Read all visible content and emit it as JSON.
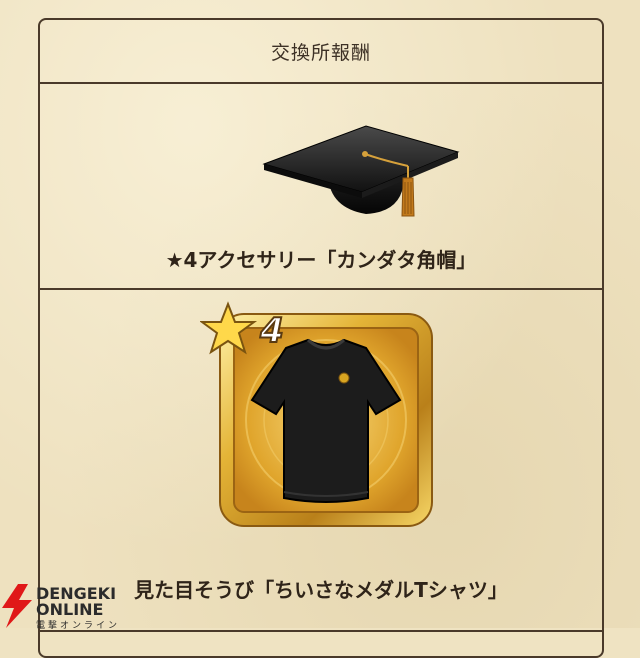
{
  "header": {
    "title": "交換所報酬"
  },
  "rewards": [
    {
      "name": "★4アクセサリー「カンダタ角帽」",
      "icon": "graduation-cap-icon"
    },
    {
      "name": "見た目そうび「ちいさなメダルTシャツ」",
      "icon": "black-tshirt-icon",
      "badge": "4"
    }
  ],
  "watermark": {
    "line1": "DENGEKI",
    "line2": "ONLINE",
    "line3": "電撃オンライン"
  },
  "colors": {
    "parchment": "#eee1bf",
    "border": "#4a3a2a",
    "gold": "#d9a521"
  }
}
